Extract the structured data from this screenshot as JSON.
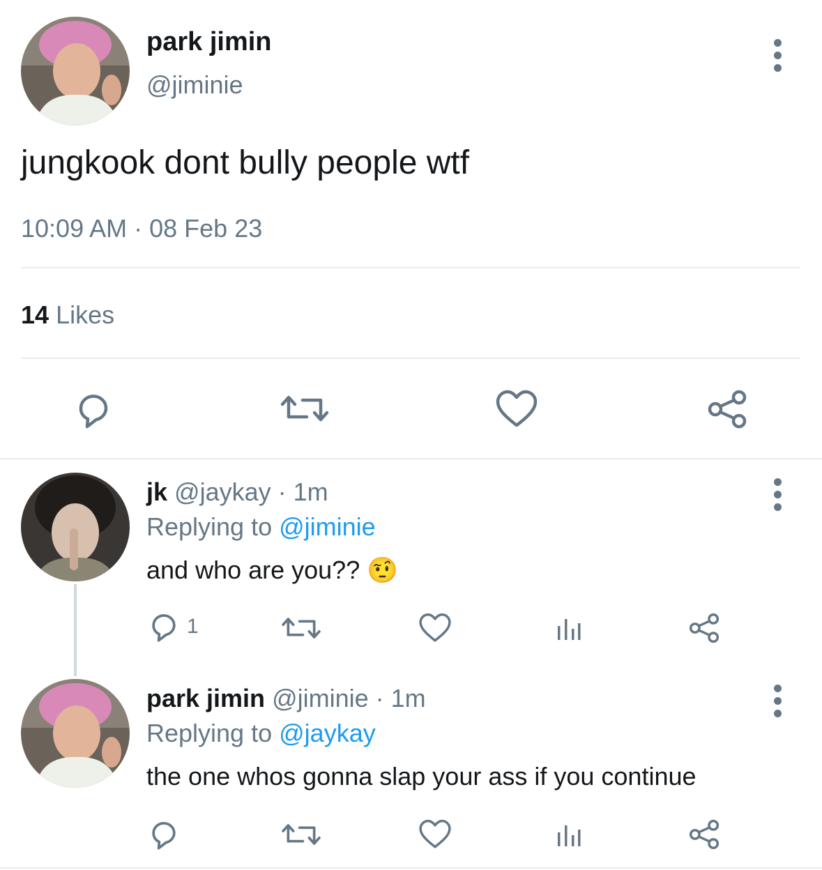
{
  "tweet": {
    "name": "park jimin",
    "handle": "@jiminie",
    "text": "jungkook dont bully people wtf",
    "time": "10:09 AM",
    "dot": " · ",
    "date": "08 Feb 23",
    "likes_count": "14",
    "likes_label": "Likes"
  },
  "replies": [
    {
      "name": "jk",
      "handle": "@jaykay",
      "time": "· 1m",
      "replying_prefix": "Replying to",
      "replying_handle": "@jiminie",
      "text": "and who are you??",
      "emoji": "🤨",
      "reply_count": "1"
    },
    {
      "name": "park jimin",
      "handle": "@jiminie",
      "time": "· 1m",
      "replying_prefix": "Replying to",
      "replying_handle": "@jaykay",
      "text": "the one whos gonna slap your ass if you continue",
      "reply_count": ""
    }
  ],
  "icons": {
    "reply": "speech-bubble-icon",
    "retweet": "retweet-icon",
    "like": "heart-icon",
    "share": "share-icon",
    "analytics": "analytics-icon",
    "more": "more-vertical-icon"
  },
  "colors": {
    "text": "#14171a",
    "secondary": "#657786",
    "link": "#1d9bf0",
    "divider": "#e6ecf0"
  }
}
